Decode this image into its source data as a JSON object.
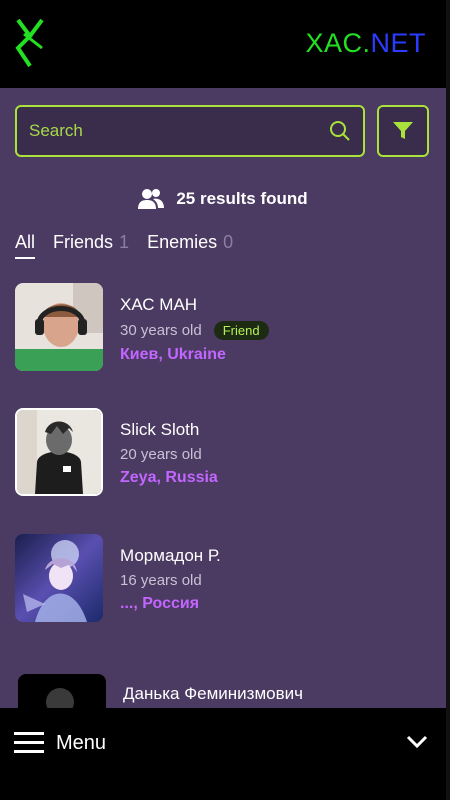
{
  "header": {
    "brand_part1": "XAC.",
    "brand_part2": "NET",
    "logo_icon": "xac-logo-icon"
  },
  "search": {
    "placeholder": "Search",
    "icon": "search-icon",
    "filter_icon": "filter-icon"
  },
  "results": {
    "icon": "users-icon",
    "text": "25 results found"
  },
  "tabs": [
    {
      "label": "All",
      "count": ""
    },
    {
      "label": "Friends",
      "count": "1"
    },
    {
      "label": "Enemies",
      "count": "0"
    }
  ],
  "people": [
    {
      "name": "ХАС МАН",
      "age": "30 years old",
      "badge": "Friend",
      "location": "Киев, Ukraine"
    },
    {
      "name": "Slick Sloth",
      "age": "20 years old",
      "badge": "",
      "location": "Zeya, Russia"
    },
    {
      "name": "Мормадон Р.",
      "age": "16 years old",
      "badge": "",
      "location": "..., Россия"
    },
    {
      "name": "Данька Феминизмович",
      "age": "",
      "badge": "",
      "location": ""
    }
  ],
  "bottom": {
    "menu_label": "Menu",
    "menu_icon": "hamburger-icon",
    "chevron_icon": "chevron-down-icon"
  },
  "colors": {
    "accent": "#a9e23a",
    "background": "#4b3a62",
    "location": "#c266ff",
    "brand_green": "#22e022",
    "brand_blue": "#2a3cff"
  }
}
